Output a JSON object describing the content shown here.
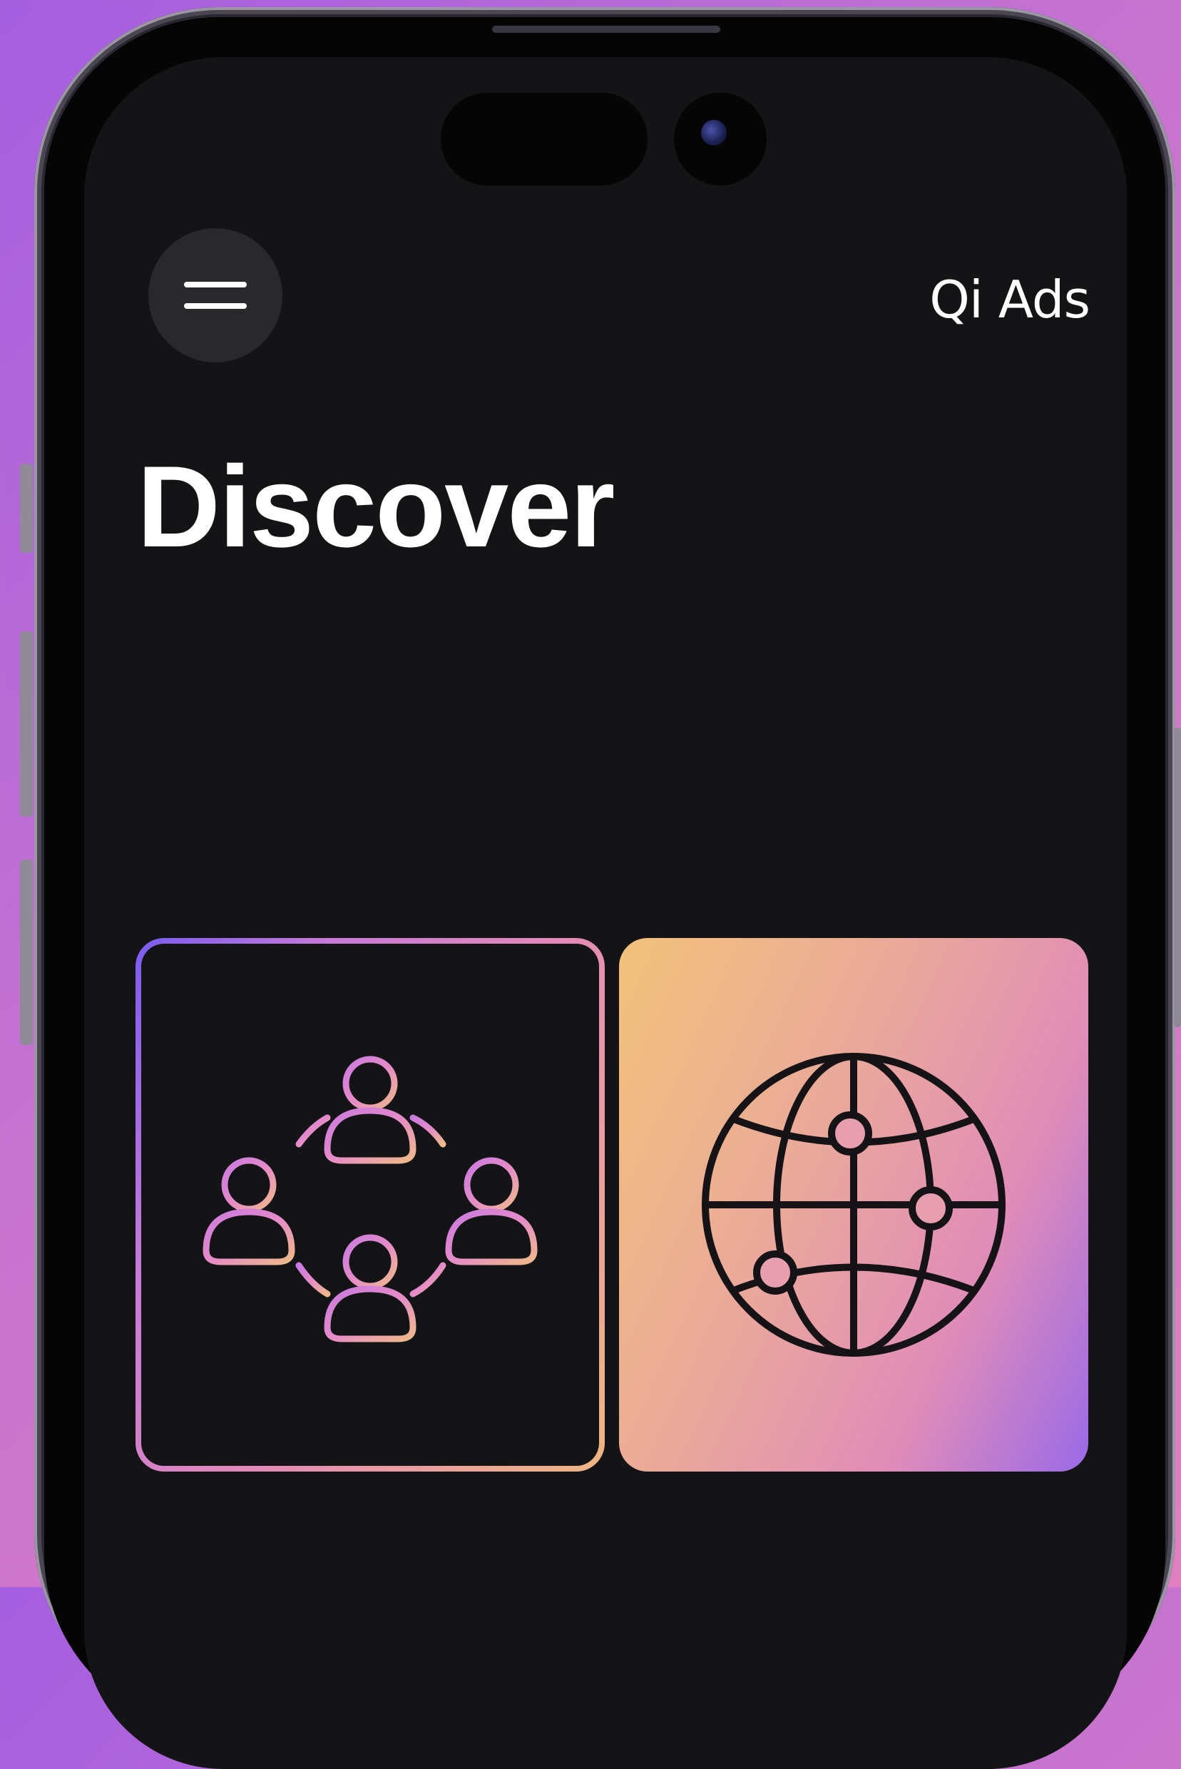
{
  "header": {
    "brand": "Qi Ads"
  },
  "page": {
    "title": "Discover"
  },
  "cards": [
    {
      "icon": "community-network-icon"
    },
    {
      "icon": "globe-network-icon"
    }
  ],
  "colors": {
    "background_gradient": [
      "#a45ee0",
      "#e07fbf"
    ],
    "screen": "#141416",
    "menu_button": "#29292c",
    "text": "#ffffff",
    "card_gradient": [
      "#7a5cf0",
      "#e38ab8",
      "#f2c27a"
    ]
  }
}
